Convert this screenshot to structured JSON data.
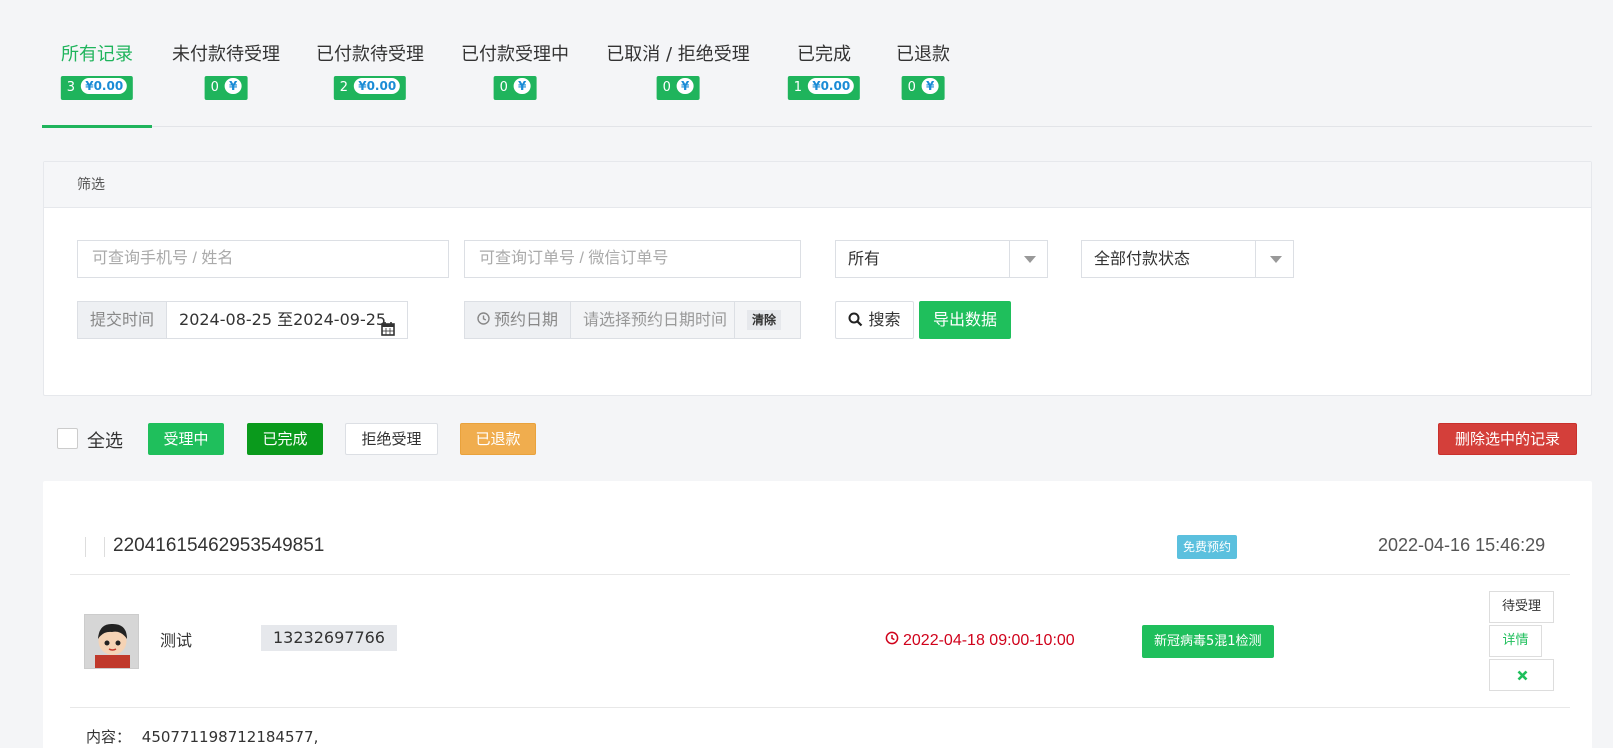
{
  "tabs": [
    {
      "label": "所有记录",
      "count": "3",
      "amount": "¥0.00"
    },
    {
      "label": "未付款待受理",
      "count": "0",
      "amount": "¥"
    },
    {
      "label": "已付款待受理",
      "count": "2",
      "amount": "¥0.00"
    },
    {
      "label": "已付款受理中",
      "count": "0",
      "amount": "¥"
    },
    {
      "label": "已取消 / 拒绝受理",
      "count": "0",
      "amount": "¥"
    },
    {
      "label": "已完成",
      "count": "1",
      "amount": "¥0.00"
    },
    {
      "label": "已退款",
      "count": "0",
      "amount": "¥"
    }
  ],
  "colors": {
    "accent": "#1fb45c",
    "danger": "#d43f3a",
    "warning": "#f0ad4e",
    "info": "#5bc0de",
    "amount": "#1b8cd6"
  },
  "filter": {
    "title": "筛选",
    "phone_placeholder": "可查询手机号 / 姓名",
    "order_placeholder": "可查询订单号 / 微信订单号",
    "select_all": "所有",
    "select_payment": "全部付款状态",
    "submit_time_label": "提交时间",
    "submit_time_value": "2024-08-25 至2024-09-25",
    "booking_date_label": "预约日期",
    "booking_date_placeholder": "请选择预约日期时间",
    "clear_label": "清除",
    "search_label": "搜索",
    "export_label": "导出数据"
  },
  "actions": {
    "select_all": "全选",
    "processing": "受理中",
    "completed": "已完成",
    "reject": "拒绝受理",
    "refunded": "已退款",
    "delete_selected": "删除选中的记录"
  },
  "record": {
    "order_no": "22041615462953549851",
    "tag": "免费预约",
    "created_at": "2022-04-16 15:46:29",
    "name": "测试",
    "phone": "13232697766",
    "booking_time": "2022-04-18 09:00-10:00",
    "service": "新冠病毒5混1检测",
    "status_button": "待受理",
    "detail_button": "详情",
    "content_label": "内容：",
    "content_value": "450771198712184577,"
  }
}
